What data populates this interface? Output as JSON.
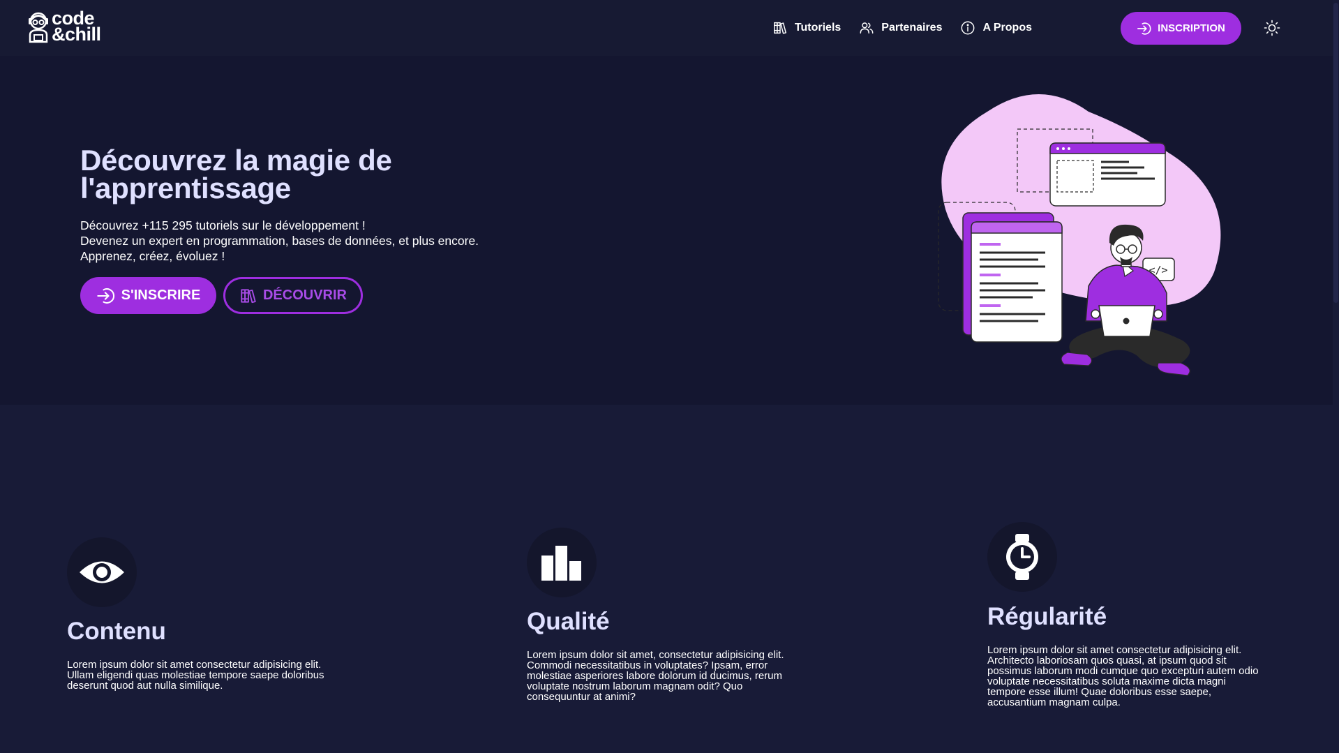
{
  "brand": {
    "line1": "code",
    "line2": "&chill"
  },
  "nav": {
    "links": [
      {
        "label": "Tutoriels",
        "icon": "books-icon"
      },
      {
        "label": "Partenaires",
        "icon": "users-icon"
      },
      {
        "label": "A Propos",
        "icon": "info-icon"
      }
    ],
    "cta_label": "INSCRIPTION",
    "theme_icon": "sun-icon"
  },
  "hero": {
    "title": "Découvrez la magie de l'apprentissage",
    "lines": [
      "Découvrez +115 295 tutoriels sur le développement !",
      "Devenez un expert en programmation, bases de données, et plus encore.",
      "Apprenez, créez, évoluez !"
    ],
    "primary_button": "S'INSCRIRE",
    "secondary_button": "DÉCOUVRIR"
  },
  "features": [
    {
      "icon": "eye-icon",
      "title": "Contenu",
      "text": "Lorem ipsum dolor sit amet consectetur adipisicing elit. Ullam eligendi quas molestiae tempore saepe doloribus deserunt quod aut nulla similique."
    },
    {
      "icon": "bar-chart-icon",
      "title": "Qualité",
      "text": "Lorem ipsum dolor sit amet, consectetur adipisicing elit. Commodi necessitatibus in voluptates? Ipsam, error molestiae asperiores labore dolorum id ducimus, rerum voluptate nostrum laborum magnam odit? Quo consequuntur at animi?"
    },
    {
      "icon": "watch-icon",
      "title": "Régularité",
      "text": "Lorem ipsum dolor sit amet consectetur adipisicing elit. Architecto laboriosam quos quasi, at ipsum quod sit possimus laborum modi cumque quo excepturi autem odio voluptate necessitatibus soluta maxime dicta magni tempore esse illum! Quae doloribus esse saepe, accusantium magnam culpa."
    }
  ],
  "colors": {
    "accent": "#9e2ee0",
    "background": "#181b37",
    "hero_background": "#141630",
    "heading": "#dfe0ff"
  }
}
